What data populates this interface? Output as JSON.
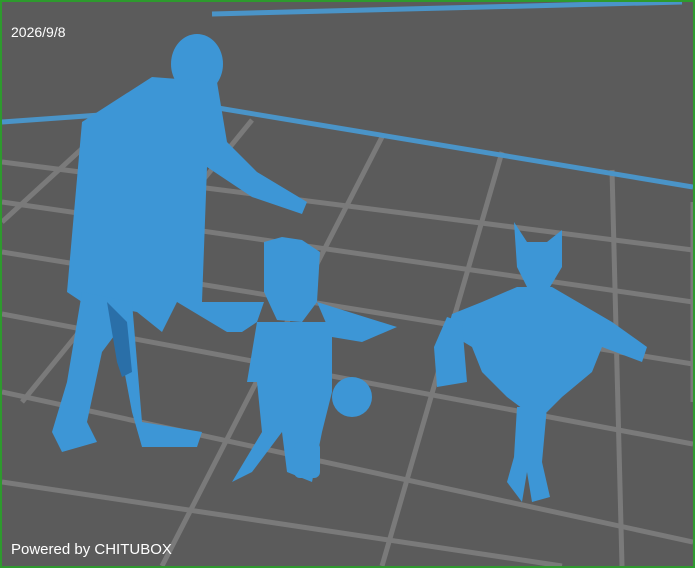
{
  "viewer": {
    "date_stamp": "2026/9/8",
    "watermark": "Powered by CHITUBOX",
    "colors": {
      "background": "#5b5b5b",
      "grid": "#7a7a7a",
      "platform_edge": "#4a94c8",
      "model": "#3d96d6",
      "model_shadow": "#2a6fa8",
      "frame": "#2e9a2e"
    },
    "models": [
      {
        "name": "adult-man-pointing"
      },
      {
        "name": "child-dragon-costume"
      },
      {
        "name": "child-bat-costume"
      }
    ]
  }
}
